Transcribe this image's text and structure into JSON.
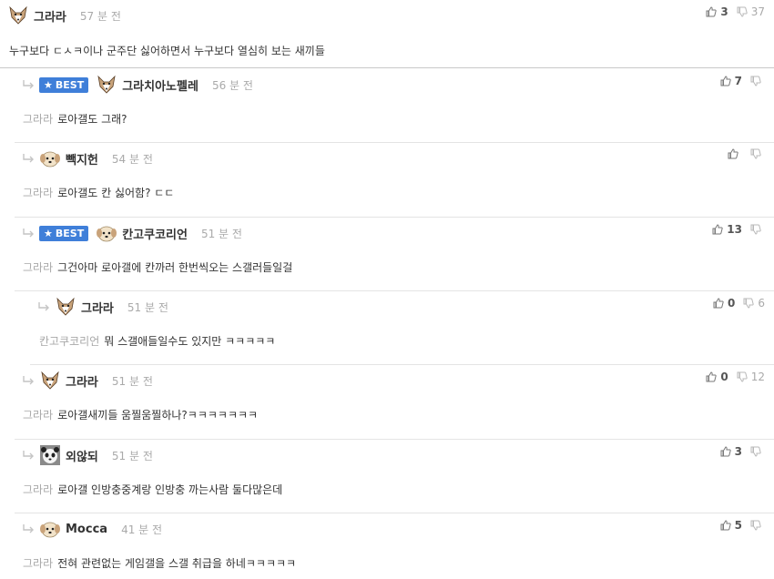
{
  "comments": [
    {
      "nickname": "그라라",
      "time": "57 분 전",
      "best": false,
      "reply": false,
      "avatar": "chihuahua",
      "mention": "",
      "text": "누구보다 ㄷㅅㅋ이나 군주단 싫어하면서 누구보다 열심히 보는 새끼들",
      "up": "3",
      "down": "37"
    },
    {
      "nickname": "그라치아노펠레",
      "time": "56 분 전",
      "best": true,
      "reply": true,
      "avatar": "chihuahua",
      "mention": "그라라",
      "text": "로아갤도 그래?",
      "up": "7",
      "down": ""
    },
    {
      "nickname": "빽지헌",
      "time": "54 분 전",
      "best": false,
      "reply": true,
      "avatar": "puppy",
      "mention": "그라라",
      "text": "로아갤도 칸 싫어함? ㄷㄷ",
      "up": "",
      "down": ""
    },
    {
      "nickname": "칸고쿠코리언",
      "time": "51 분 전",
      "best": true,
      "reply": true,
      "avatar": "puppy",
      "mention": "그라라",
      "text": "그건아마 로아갤에 칸까러 한번씩오는 스갤러들일걸",
      "up": "13",
      "down": ""
    },
    {
      "nickname": "그라라",
      "time": "51 분 전",
      "best": false,
      "reply": true,
      "avatar": "chihuahua",
      "mention": "칸고쿠코리언",
      "text": "뭐 스갤애들일수도 있지만 ㅋㅋㅋㅋㅋ",
      "up": "0",
      "down": "6"
    },
    {
      "nickname": "그라라",
      "time": "51 분 전",
      "best": false,
      "reply": true,
      "avatar": "chihuahua",
      "mention": "그라라",
      "text": "로아갤새끼들 움찔움찔하나?ㅋㅋㅋㅋㅋㅋㅋ",
      "up": "0",
      "down": "12"
    },
    {
      "nickname": "외않되",
      "time": "51 분 전",
      "best": false,
      "reply": true,
      "avatar": "panda",
      "mention": "그라라",
      "text": "로아갤 인방충중계랑 인방충 까는사람 둘다많은데",
      "up": "3",
      "down": ""
    },
    {
      "nickname": "Mocca",
      "time": "41 분 전",
      "best": false,
      "reply": true,
      "avatar": "puppy",
      "mention": "그라라",
      "text": "전혀 관련없는 게임갤을 스갤 취급을 하네ㅋㅋㅋㅋㅋ",
      "up": "5",
      "down": ""
    }
  ],
  "labels": {
    "best": "BEST"
  },
  "icons": {
    "like": "thumbs-up-icon",
    "dislike": "thumbs-down-icon",
    "reply": "reply-arrow-icon"
  },
  "colors": {
    "best_badge": "#3f7fd9",
    "mention": "#a8a8a8",
    "time": "#aaaaaa",
    "divider": "#e4e4e4"
  }
}
